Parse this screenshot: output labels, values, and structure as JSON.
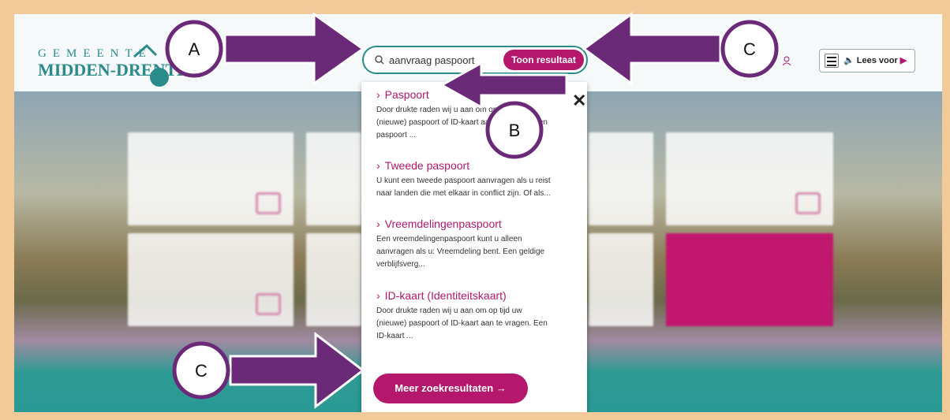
{
  "header": {
    "logo_top": "GEMEENTE",
    "logo_bottom": "MIDDEN-DRENTHE",
    "search_value": "aanvraag paspoort",
    "search_button": "Toon resultaat",
    "read_aloud": "Lees voor",
    "icons": [
      "search-icon",
      "menu-icon",
      "speaker-icon",
      "play-icon",
      "user-icon"
    ]
  },
  "dropdown": {
    "results": [
      {
        "title": "Paspoort",
        "desc_lines": [
          "Door drukte raden wij u aan om op tijd uw",
          "(nieuwe) paspoort of ID-kaart aan te vragen. Een",
          "paspoort ..."
        ]
      },
      {
        "title": "Tweede paspoort",
        "desc_lines": [
          "U kunt een tweede paspoort aanvragen als u reist",
          "naar landen die met elkaar in conflict zijn. Of als..."
        ]
      },
      {
        "title": "Vreemdelingenpaspoort",
        "desc_lines": [
          "Een vreemdelingenpaspoort kunt u alleen",
          "aanvragen als u: Vreemdeling bent. Een geldige",
          "verblijfsverg..."
        ]
      },
      {
        "title": "ID-kaart (Identiteitskaart)",
        "desc_lines": [
          "Door drukte raden wij u aan om op tijd uw",
          "(nieuwe) paspoort of ID-kaart aan te vragen. Een",
          "ID-kaart ..."
        ]
      }
    ],
    "more_button": "Meer zoekresultaten →"
  },
  "annotations": {
    "labels": [
      "A",
      "B",
      "C",
      "C"
    ],
    "arrow_color": "#6b2a78"
  },
  "colors": {
    "accent": "#b5176c",
    "brand": "#2b8b8a",
    "frame": "#f2c998"
  }
}
